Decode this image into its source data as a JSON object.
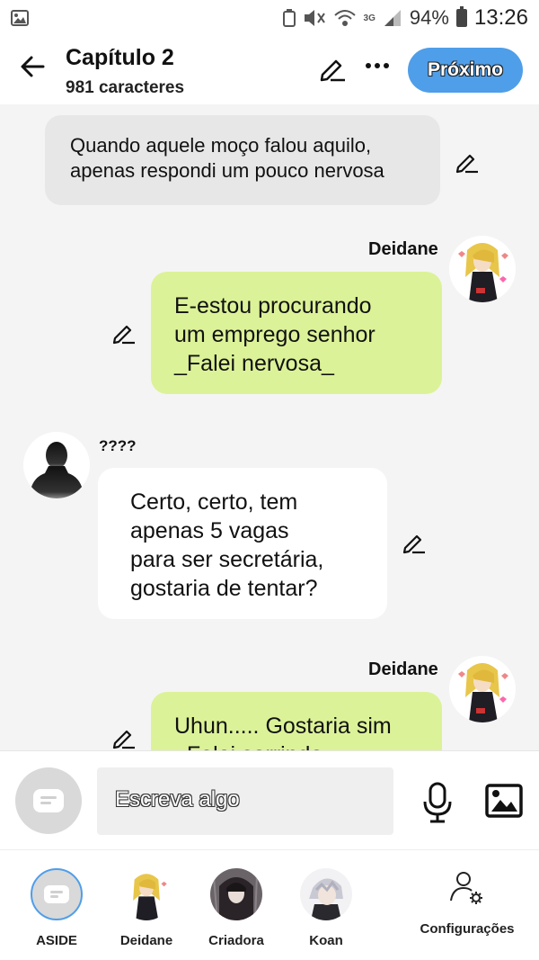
{
  "status_bar": {
    "battery_percent": "94%",
    "time": "13:26",
    "network": "3G"
  },
  "header": {
    "title": "Capítulo 2",
    "subtitle": "981 caracteres",
    "next_label": "Próximo"
  },
  "messages": [
    {
      "type": "narration",
      "text_line1": "Quando aquele moço falou aquilo,",
      "text_line2": "apenas respondi um pouco nervosa"
    },
    {
      "type": "right",
      "sender": "Deidane",
      "lines": [
        "E-estou procurando",
        "um emprego senhor",
        "_Falei nervosa_"
      ]
    },
    {
      "type": "left",
      "sender": "????",
      "lines": [
        "Certo, certo, tem",
        "apenas 5 vagas",
        "para ser secretária,",
        "gostaria de tentar?"
      ]
    },
    {
      "type": "right",
      "sender": "Deidane",
      "lines": [
        "Uhun..... Gostaria sim",
        "_Falei sorrindo_"
      ]
    }
  ],
  "input": {
    "placeholder": "Escreva algo"
  },
  "characters": [
    {
      "name": "ASIDE"
    },
    {
      "name": "Deidane"
    },
    {
      "name": "Criadora"
    },
    {
      "name": "Koan"
    }
  ],
  "settings_label": "Configurações",
  "colors": {
    "accent": "#4f9ee9",
    "user_bubble": "#dcf298",
    "narration_bubble": "#e7e7e7",
    "other_bubble": "#ffffff"
  }
}
